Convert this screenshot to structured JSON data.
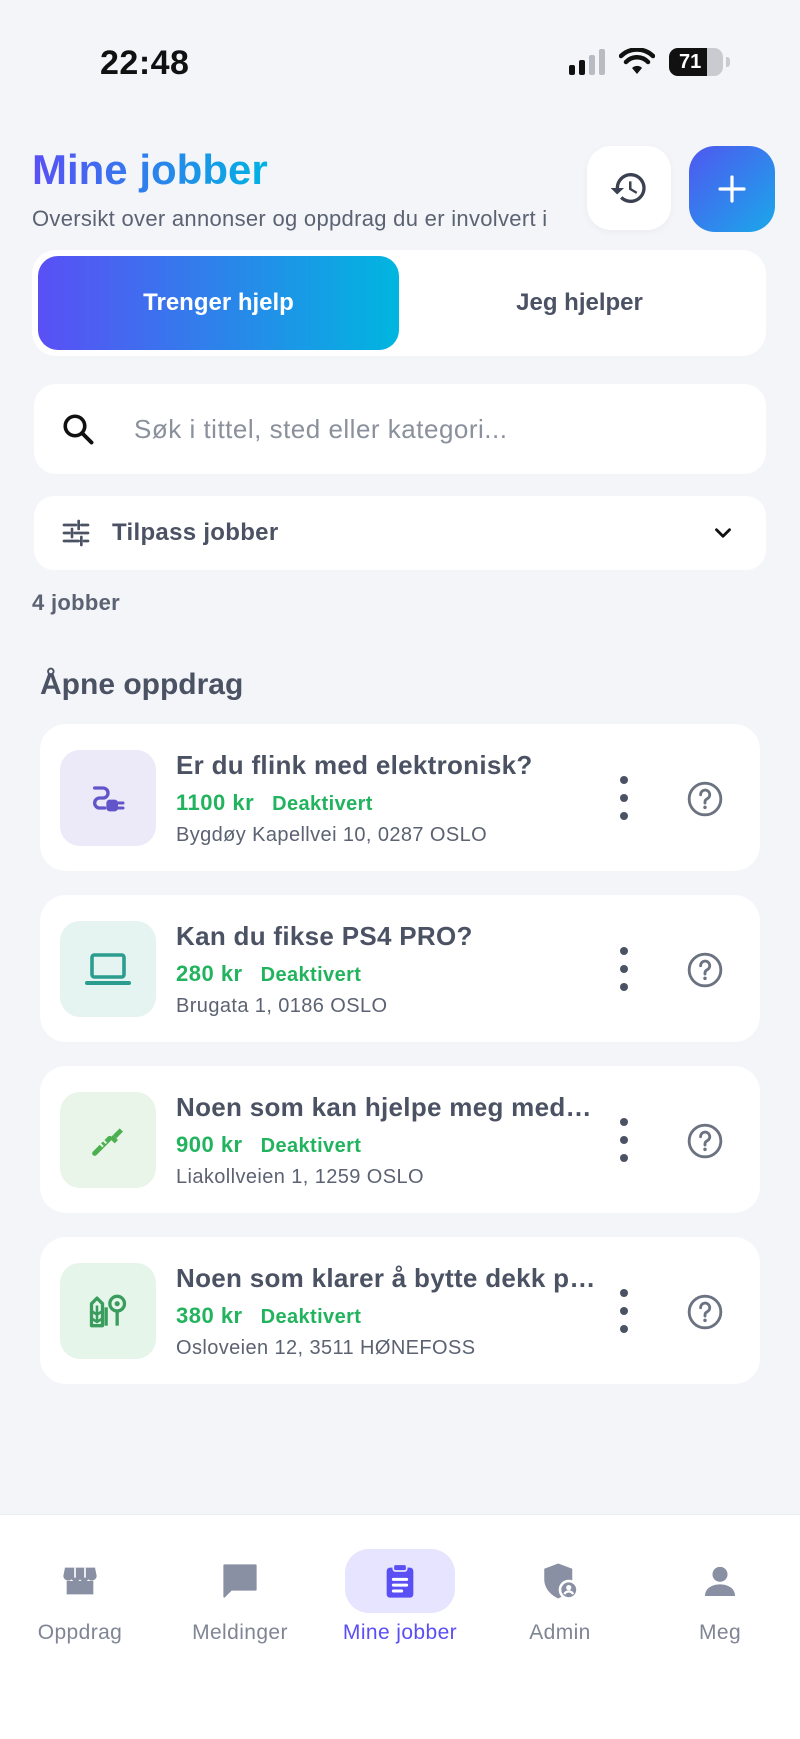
{
  "status_bar": {
    "time": "22:48",
    "battery": "71",
    "battery_level": 0.71
  },
  "header": {
    "title": "Mine jobber",
    "subtitle": "Oversikt over annonser og oppdrag du er involvert i",
    "history_icon": "history-icon",
    "add_icon": "plus-icon"
  },
  "segment": {
    "tabs": [
      {
        "label": "Trenger hjelp",
        "active": true
      },
      {
        "label": "Jeg hjelper",
        "active": false
      }
    ]
  },
  "search": {
    "placeholder": "Søk i tittel, sted eller kategori...",
    "value": ""
  },
  "filter": {
    "label": "Tilpass jobber"
  },
  "job_count": "4 jobber",
  "section_title": "Åpne oppdrag",
  "jobs": [
    {
      "title": "Er du flink med elektronisk?",
      "price": "1100 kr",
      "status": "Deaktivert",
      "address": "Bygdøy Kapellvei 10, 0287 OSLO",
      "icon": "plug-icon",
      "thumb_color": "#ece9f8"
    },
    {
      "title": "Kan du fikse PS4 PRO?",
      "price": "280 kr",
      "status": "Deaktivert",
      "address": "Brugata 1, 0186 OSLO",
      "icon": "laptop-icon",
      "thumb_color": "#e5f3f1"
    },
    {
      "title": "Noen som kan hjelpe meg med rørlegging?",
      "price": "900 kr",
      "status": "Deaktivert",
      "address": "Liakollveien 1, 1259 OSLO",
      "icon": "wrench-icon",
      "thumb_color": "#e8f5e8"
    },
    {
      "title": "Noen som klarer å bytte dekk på bilen?",
      "price": "380 kr",
      "status": "Deaktivert",
      "address": "Osloveien 12, 3511 HØNEFOSS",
      "icon": "garden-location-icon",
      "thumb_color": "#e5f5ea"
    }
  ],
  "nav": [
    {
      "label": "Oppdrag",
      "icon": "store-icon",
      "active": false
    },
    {
      "label": "Meldinger",
      "icon": "chat-icon",
      "active": false
    },
    {
      "label": "Mine jobber",
      "icon": "clipboard-icon",
      "active": true
    },
    {
      "label": "Admin",
      "icon": "admin-shield-icon",
      "active": false
    },
    {
      "label": "Meg",
      "icon": "person-icon",
      "active": false
    }
  ],
  "colors": {
    "accent": "#5a4ff5",
    "accent_2": "#00b3e3",
    "success": "#22b35e",
    "background": "#f4f5f9"
  }
}
